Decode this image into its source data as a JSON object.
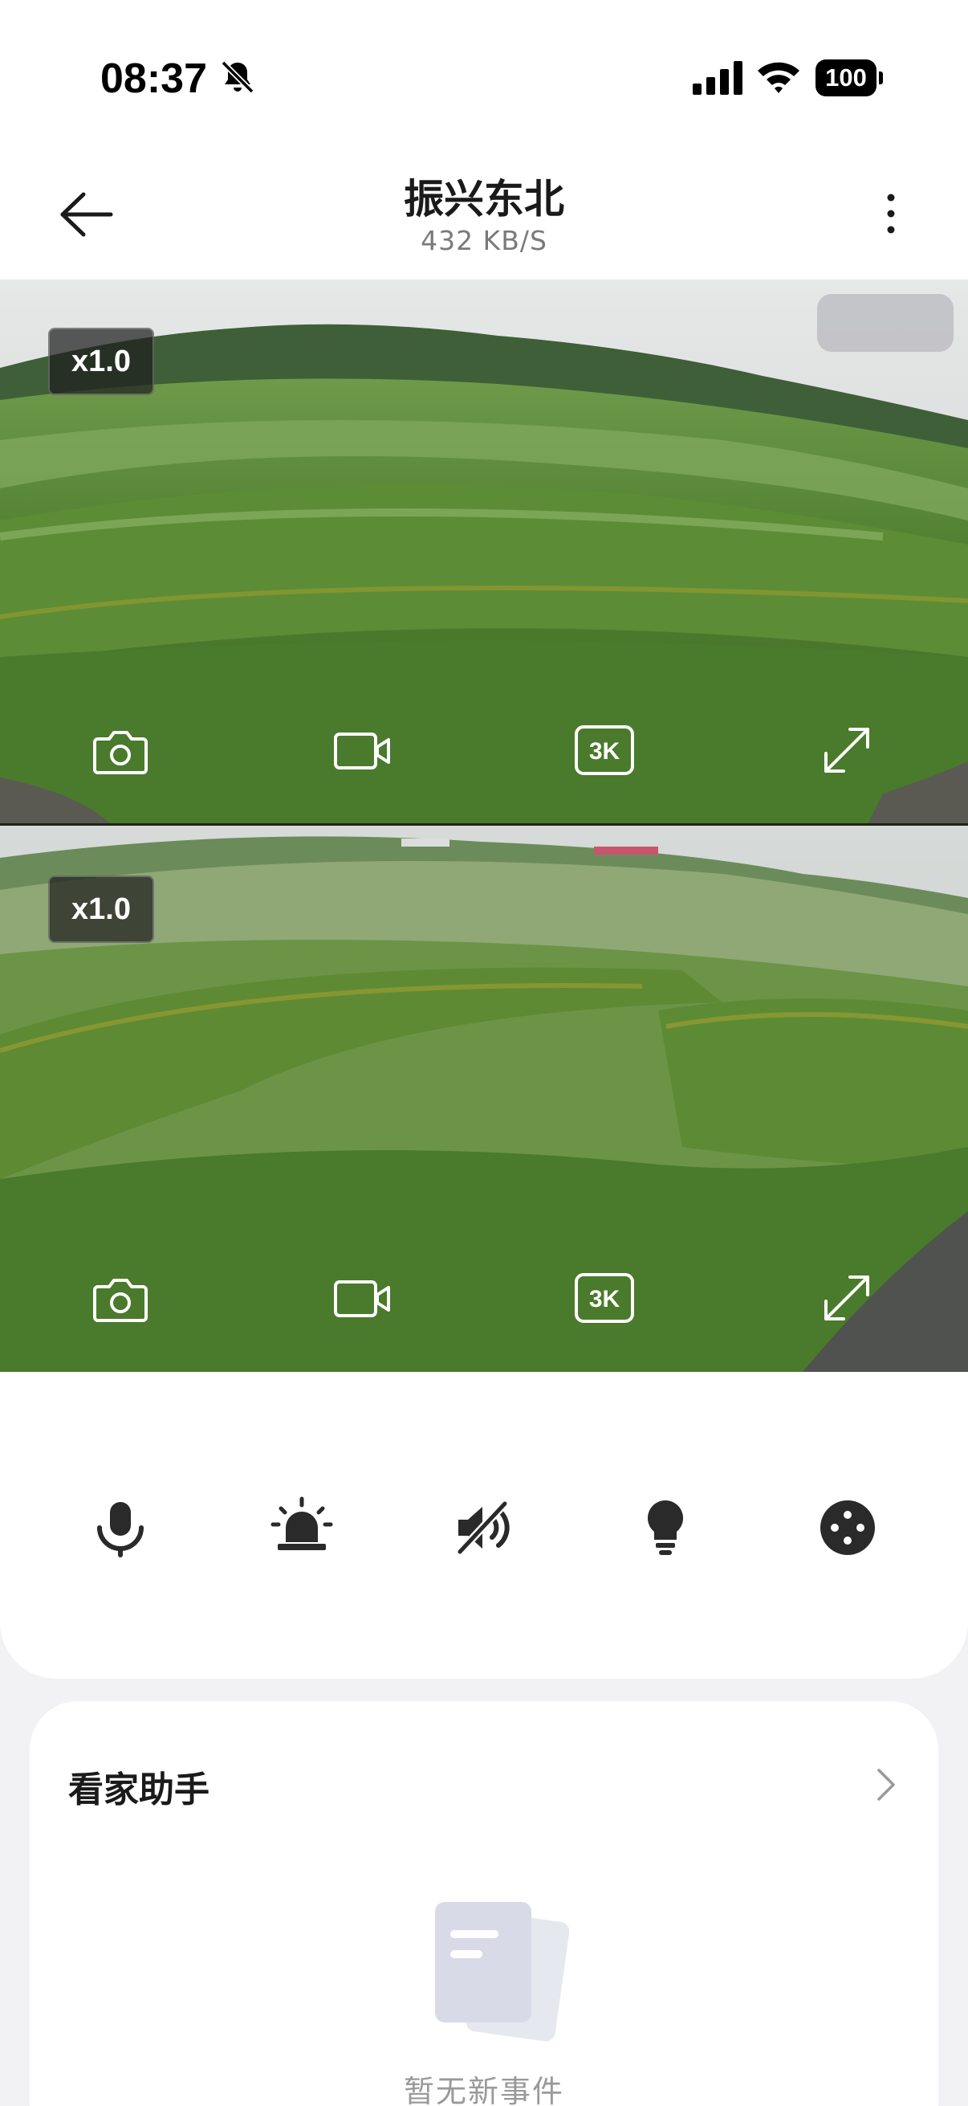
{
  "status_bar": {
    "time": "08:37",
    "battery": "100",
    "icons": [
      "bell-off-icon",
      "cellular-signal-icon",
      "wifi-icon",
      "battery-icon"
    ]
  },
  "header": {
    "title": "振兴东北",
    "bitrate": "432 KB/S"
  },
  "feeds": [
    {
      "zoom": "x1.0",
      "quality_label": "3K"
    },
    {
      "zoom": "x1.0",
      "quality_label": "3K"
    }
  ],
  "toolbar": {
    "items": [
      "microphone-icon",
      "siren-icon",
      "mute-icon",
      "lightbulb-icon",
      "more-options-icon"
    ]
  },
  "assistant": {
    "title": "看家助手",
    "empty_text": "暂无新事件"
  },
  "colors": {
    "background": "#f2f2f4",
    "card": "#ffffff",
    "text_primary": "#1a1a1a",
    "text_secondary": "#7a7a7a",
    "icon_dark": "#2a2a2a"
  }
}
